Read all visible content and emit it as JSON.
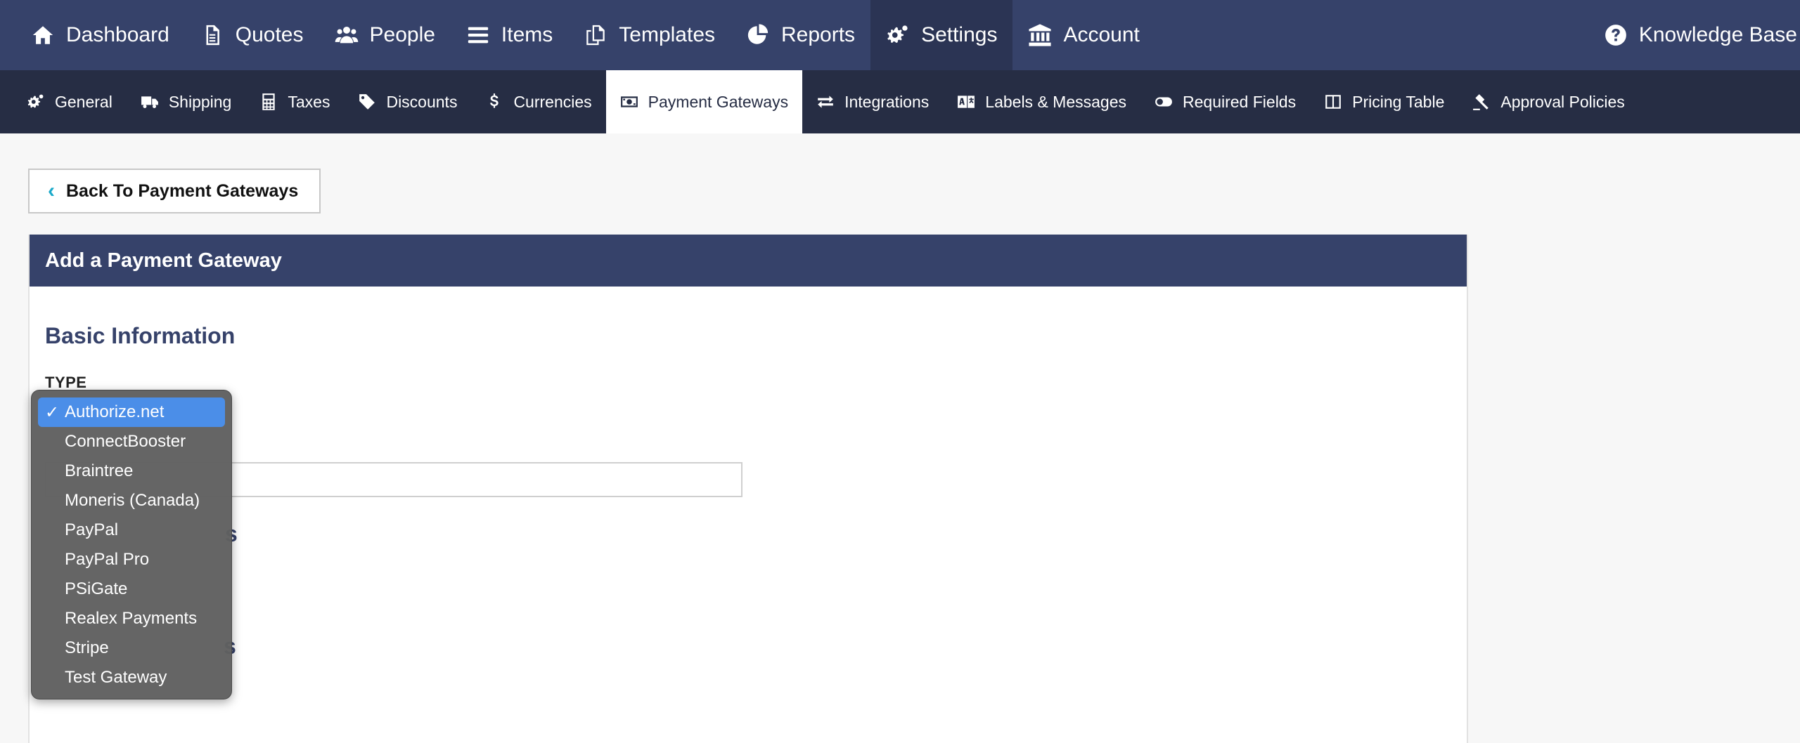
{
  "topnav": {
    "items": [
      {
        "label": "Dashboard",
        "icon": "home-icon"
      },
      {
        "label": "Quotes",
        "icon": "document-icon"
      },
      {
        "label": "People",
        "icon": "people-icon"
      },
      {
        "label": "Items",
        "icon": "list-icon"
      },
      {
        "label": "Templates",
        "icon": "copy-icon"
      },
      {
        "label": "Reports",
        "icon": "pie-chart-icon"
      },
      {
        "label": "Settings",
        "icon": "gears-icon"
      },
      {
        "label": "Account",
        "icon": "bank-icon"
      }
    ],
    "active": "Settings",
    "knowledge_base": "Knowledge Base"
  },
  "subnav": {
    "items": [
      {
        "label": "General",
        "icon": "gears-icon"
      },
      {
        "label": "Shipping",
        "icon": "truck-icon"
      },
      {
        "label": "Taxes",
        "icon": "calculator-icon"
      },
      {
        "label": "Discounts",
        "icon": "tag-icon"
      },
      {
        "label": "Currencies",
        "icon": "dollar-icon"
      },
      {
        "label": "Payment Gateways",
        "icon": "money-icon"
      },
      {
        "label": "Integrations",
        "icon": "exchange-icon"
      },
      {
        "label": "Labels & Messages",
        "icon": "language-icon"
      },
      {
        "label": "Required Fields",
        "icon": "toggle-icon"
      },
      {
        "label": "Pricing Table",
        "icon": "columns-icon"
      },
      {
        "label": "Approval Policies",
        "icon": "gavel-icon"
      }
    ],
    "active": "Payment Gateways"
  },
  "back_button": {
    "label": "Back To Payment Gateways"
  },
  "panel": {
    "title": "Add a Payment Gateway",
    "section_title": "Basic Information",
    "type_label": "TYPE",
    "partial_heading_1": "s",
    "partial_heading_2": "s"
  },
  "dropdown": {
    "selected": "Authorize.net",
    "options": [
      "Authorize.net",
      "ConnectBooster",
      "Braintree",
      "Moneris (Canada)",
      "PayPal",
      "PayPal Pro",
      "PSiGate",
      "Realex Payments",
      "Stripe",
      "Test Gateway"
    ]
  },
  "colors": {
    "topnav_bg": "#36426a",
    "subnav_bg": "#262d44",
    "accent": "#1aa9c9",
    "selection": "#4b8ee8"
  }
}
